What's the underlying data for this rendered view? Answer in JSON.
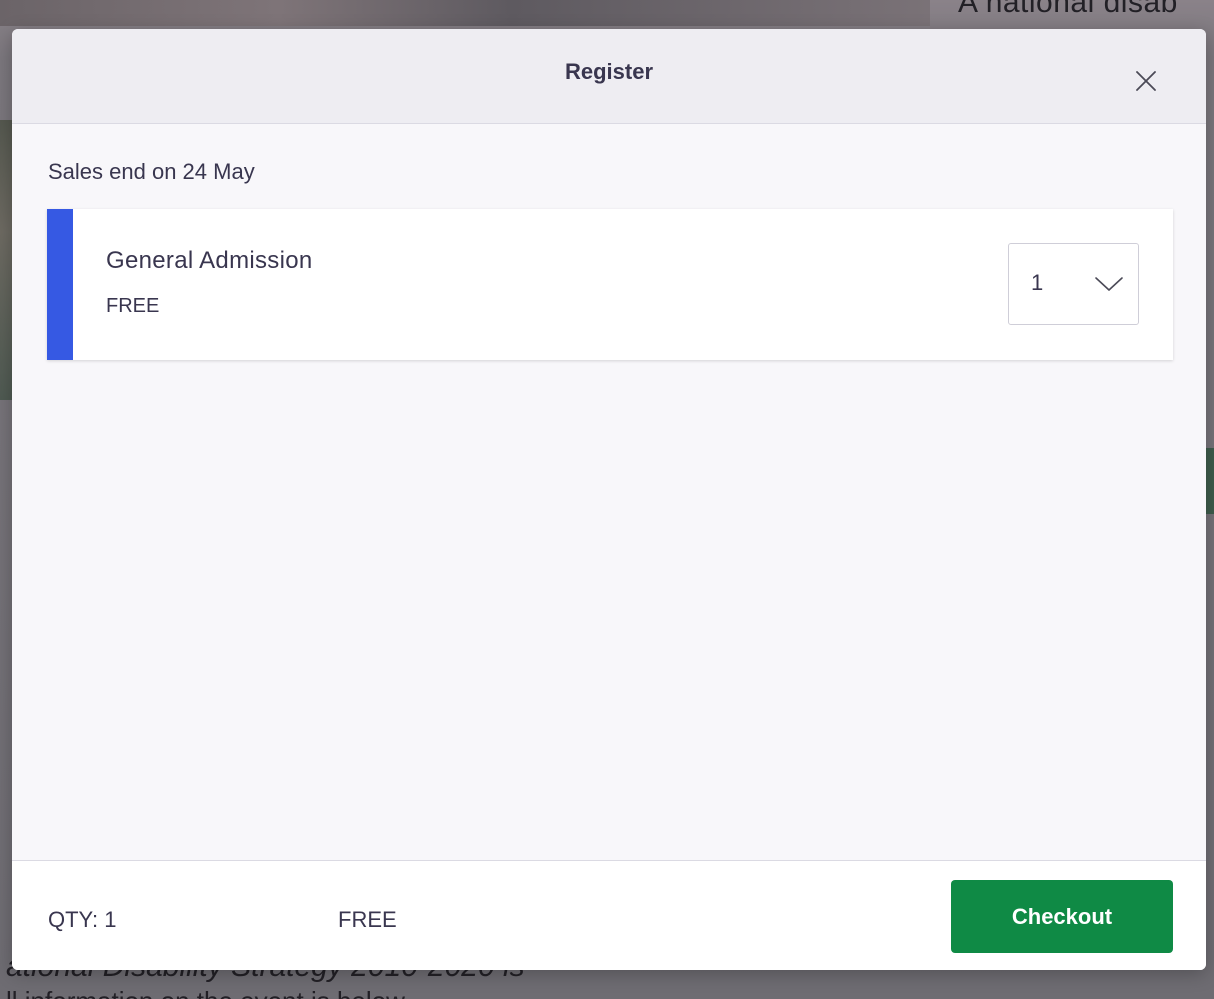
{
  "background_page": {
    "top_text": "A national disab",
    "bottom_text": "ational Disability Strategy 2010-2020 is",
    "bottom_text_2": "ll information on the event is below"
  },
  "modal": {
    "title": "Register",
    "close_icon": "close-icon",
    "sales_end": "Sales end on 24 May",
    "ticket": {
      "name": "General Admission",
      "price": "FREE",
      "quantity": "1",
      "quantity_icon": "chevron-down-icon"
    },
    "footer": {
      "qty_label": "QTY: 1",
      "total": "FREE",
      "checkout_label": "Checkout"
    }
  },
  "colors": {
    "accent": "#3659e3",
    "checkout": "#0f8a45",
    "text": "#39364f"
  }
}
